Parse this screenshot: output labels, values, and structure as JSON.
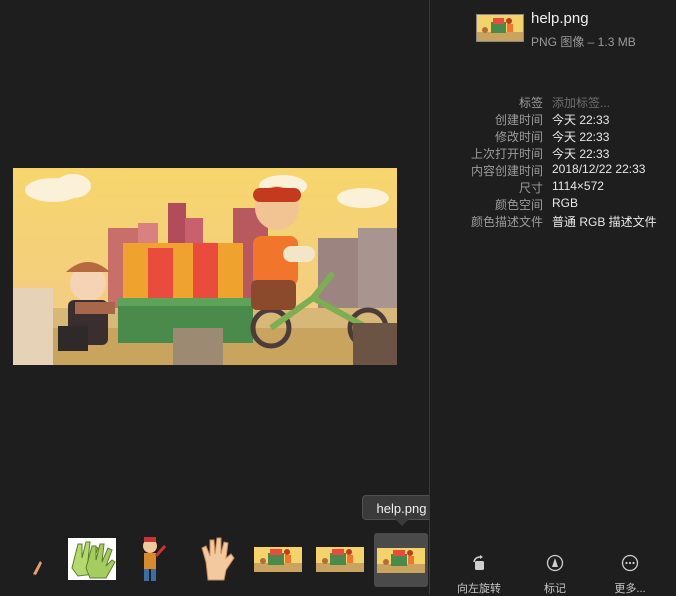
{
  "file": {
    "name": "help.png",
    "subtitle": "PNG 图像 – 1.3 MB"
  },
  "info": [
    {
      "label": "标签",
      "value": "添加标签...",
      "placeholder": true
    },
    {
      "label": "创建时间",
      "value": "今天 22:33"
    },
    {
      "label": "修改时间",
      "value": "今天 22:33"
    },
    {
      "label": "上次打开时间",
      "value": "今天 22:33"
    },
    {
      "label": "内容创建时间",
      "value": "2018/12/22 22:33"
    },
    {
      "label": "尺寸",
      "value": "1114×572"
    },
    {
      "label": "颜色空间",
      "value": "RGB"
    },
    {
      "label": "颜色描述文件",
      "value": "普通 RGB 描述文件"
    }
  ],
  "tooltip": "help.png",
  "actions": [
    {
      "label": "向左旋转",
      "icon": "rotate-left-icon"
    },
    {
      "label": "标记",
      "icon": "markup-icon"
    },
    {
      "label": "更多...",
      "icon": "more-icon"
    }
  ],
  "filmstrip": [
    {
      "name": "pencil-thumbnail"
    },
    {
      "name": "gloves-thumbnail"
    },
    {
      "name": "boy-character-thumbnail"
    },
    {
      "name": "hand-thumbnail"
    },
    {
      "name": "help-png-thumbnail-1"
    },
    {
      "name": "help-png-thumbnail-2"
    },
    {
      "name": "help-png-thumbnail-selected",
      "selected": true
    }
  ],
  "colors": {
    "background": "#1e1e1e",
    "divider": "#3a3a3a",
    "label": "#9c9c9c",
    "value": "#e8e8e8",
    "placeholder": "#6e6e6e"
  }
}
